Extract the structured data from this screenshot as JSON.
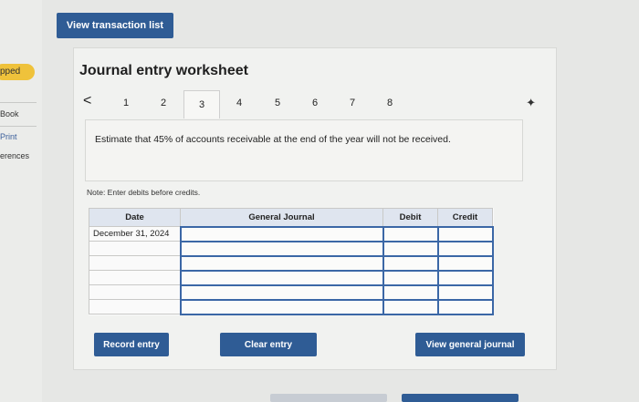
{
  "sidebar": {
    "badge": "pped",
    "links": [
      "Book",
      "Print",
      "erences"
    ]
  },
  "top_button": "View transaction list",
  "worksheet": {
    "title": "Journal entry worksheet",
    "nav": {
      "prev": "<",
      "pages": [
        "1",
        "2",
        "3",
        "4",
        "5",
        "6",
        "7",
        "8"
      ],
      "active": "3",
      "next_icon": "✦"
    },
    "description": "Estimate that 45% of accounts receivable at the end of the year will not be received.",
    "note": "Note: Enter debits before credits.",
    "table": {
      "headers": [
        "Date",
        "General Journal",
        "Debit",
        "Credit"
      ],
      "first_date": "December 31, 2024"
    },
    "buttons": {
      "record": "Record entry",
      "clear": "Clear entry",
      "view": "View general journal"
    }
  },
  "colors": {
    "accent": "#2f5c95",
    "badge": "#efc23b"
  }
}
